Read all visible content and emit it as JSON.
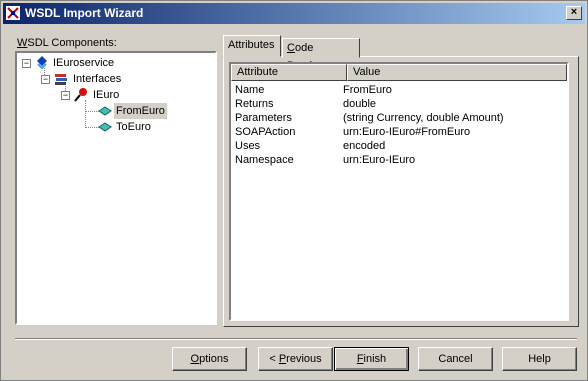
{
  "window": {
    "title": "WSDL Import Wizard"
  },
  "components_label": {
    "prefix": "W",
    "rest": "SDL Components:"
  },
  "tree": [
    {
      "label": "IEuroservice",
      "icon": "service-icon"
    },
    {
      "label": "Interfaces",
      "icon": "interfaces-icon"
    },
    {
      "label": "IEuro",
      "icon": "interface-icon"
    },
    {
      "label": "FromEuro",
      "icon": "method-icon",
      "selected": true
    },
    {
      "label": "ToEuro",
      "icon": "method-icon"
    }
  ],
  "tabs": [
    {
      "label": "Attributes",
      "active": true
    },
    {
      "label_prefix": "C",
      "label_rest": "ode Preview",
      "active": false
    }
  ],
  "table": {
    "headers": [
      "Attribute",
      "Value"
    ],
    "rows": [
      [
        "Name",
        "FromEuro"
      ],
      [
        "Returns",
        "double"
      ],
      [
        "Parameters",
        "(string Currency, double Amount)"
      ],
      [
        "SOAPAction",
        "urn:Euro-IEuro#FromEuro"
      ],
      [
        "Uses",
        "encoded"
      ],
      [
        "Namespace",
        "urn:Euro-IEuro"
      ]
    ]
  },
  "buttons": {
    "options": {
      "u": "O",
      "rest": "ptions"
    },
    "previous": {
      "pre": "< ",
      "u": "P",
      "rest": "revious"
    },
    "finish": {
      "u": "F",
      "rest": "inish"
    },
    "cancel": "Cancel",
    "help": "Help"
  }
}
